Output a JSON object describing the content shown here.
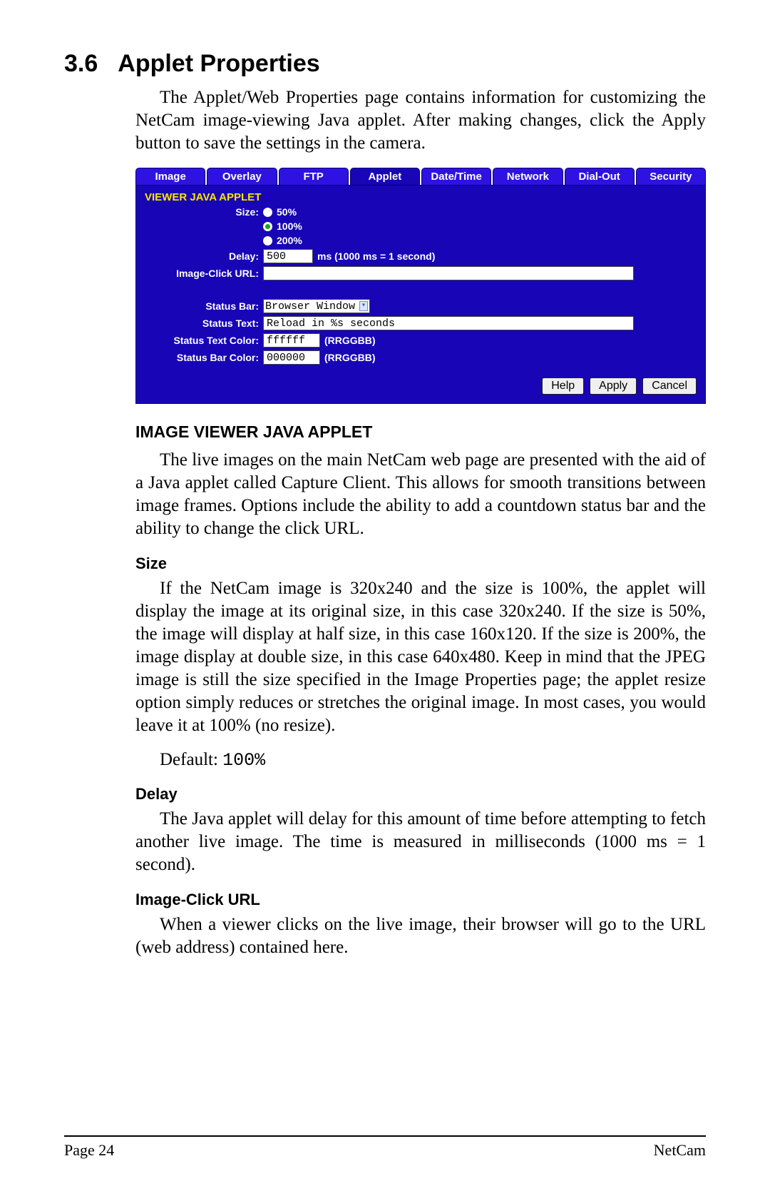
{
  "section": {
    "number": "3.6",
    "title": "Applet Properties",
    "intro": "The Applet/Web Properties page contains information for customizing the NetCam image-viewing Java applet. After making changes, click the Apply button to save the settings in the camera."
  },
  "shot": {
    "tabs": [
      "Image",
      "Overlay",
      "FTP",
      "Applet",
      "Date/Time",
      "Network",
      "Dial-Out",
      "Security"
    ],
    "active_index": 3,
    "panel_title": "VIEWER JAVA APPLET",
    "labels": {
      "size": "Size:",
      "delay": "Delay:",
      "delay_hint": "ms  (1000 ms = 1 second)",
      "image_click": "Image-Click URL:",
      "status_bar": "Status Bar:",
      "status_text": "Status Text:",
      "status_text_color": "Status Text Color:",
      "status_bar_color": "Status Bar Color:",
      "rrggbb": "(RRGGBB)"
    },
    "size_options": [
      "50%",
      "100%",
      "200%"
    ],
    "size_selected_index": 1,
    "delay_value": "500",
    "image_click_value": "",
    "status_bar_value": "Browser Window",
    "status_text_value": "Reload in %s seconds",
    "status_text_color_value": "ffffff",
    "status_bar_color_value": "000000",
    "buttons": {
      "help": "Help",
      "apply": "Apply",
      "cancel": "Cancel"
    }
  },
  "content": {
    "h_image_viewer": "IMAGE VIEWER JAVA APPLET",
    "p_image_viewer": "The live images on the main NetCam web page are presented with the aid of a Java applet called Capture Client. This allows for smooth transitions between image frames. Options include the ability to add a countdown status bar and the ability to change the click URL.",
    "h_size": "Size",
    "p_size": "If the NetCam image is 320x240 and the size is 100%, the applet will display the image at its original size, in this case 320x240. If the size is 50%, the image will display at half size, in this case 160x120. If the size is 200%, the image display at double size, in this case 640x480. Keep in mind that the JPEG image is still the size specified in the Image Properties page; the applet resize option simply reduces or stretches the original image. In most cases, you would leave it at 100% (no resize).",
    "default_label": "Default:",
    "default_size": "100%",
    "h_delay": "Delay",
    "p_delay": "The Java applet will delay for this amount of time before attempting to fetch another live image. The time is measured in milliseconds (1000 ms = 1 second).",
    "h_imgclick": "Image-Click URL",
    "p_imgclick": "When a viewer clicks on the live image, their browser will go to the URL (web address) contained here."
  },
  "footer": {
    "left": "Page 24",
    "right": "NetCam"
  }
}
